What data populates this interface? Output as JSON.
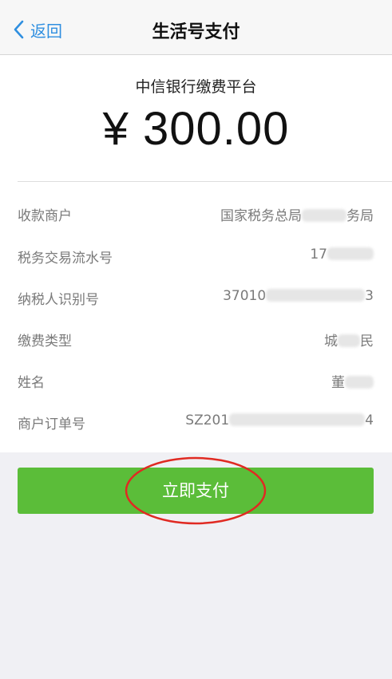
{
  "nav": {
    "back_label": "返回",
    "title": "生活号支付"
  },
  "payment": {
    "merchant_name": "中信银行缴费平台",
    "amount": "¥ 300.00"
  },
  "details": [
    {
      "label": "收款商户",
      "value_start": "国家税务总局",
      "value_end": "务局"
    },
    {
      "label": "税务交易流水号",
      "value_start": "17",
      "value_end": ""
    },
    {
      "label": "纳税人识别号",
      "value_start": "37010",
      "value_end": "3"
    },
    {
      "label": "缴费类型",
      "value_start": "城",
      "value_end": "民"
    },
    {
      "label": "姓名",
      "value_start": "董",
      "value_end": ""
    },
    {
      "label": "商户订单号",
      "value_start": "SZ201",
      "value_end": "4"
    }
  ],
  "action": {
    "pay_label": "立即支付"
  },
  "colors": {
    "accent_blue": "#2f8fe0",
    "button_green": "#5bbd39",
    "annotation_red": "#e02a22"
  }
}
